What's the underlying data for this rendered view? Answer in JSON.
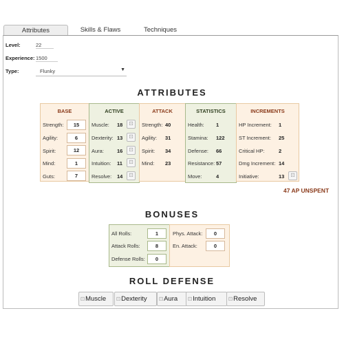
{
  "tabs": [
    "Attributes",
    "Skills & Flaws",
    "Techniques"
  ],
  "fields": {
    "level_label": "Level:",
    "level": "22",
    "experience_label": "Experience:",
    "experience": "1500",
    "type_label": "Type:",
    "type": "Flunky"
  },
  "headings": {
    "attributes": "ATTRIBUTES",
    "bonuses": "BONUSES",
    "roll_defense": "ROLL DEFENSE"
  },
  "base": {
    "title": "BASE",
    "rows": [
      {
        "label": "Strength:",
        "value": "15"
      },
      {
        "label": "Agility:",
        "value": "6"
      },
      {
        "label": "Spirit:",
        "value": "12"
      },
      {
        "label": "Mind:",
        "value": "1"
      },
      {
        "label": "Guts:",
        "value": "7"
      }
    ]
  },
  "active": {
    "title": "ACTIVE",
    "rows": [
      {
        "label": "Muscle:",
        "value": "18"
      },
      {
        "label": "Dexterity:",
        "value": "13"
      },
      {
        "label": "Aura:",
        "value": "16"
      },
      {
        "label": "Intuition:",
        "value": "11"
      },
      {
        "label": "Resolve:",
        "value": "14"
      }
    ]
  },
  "attack": {
    "title": "ATTACK",
    "rows": [
      {
        "label": "Strength:",
        "value": "40"
      },
      {
        "label": "Agility:",
        "value": "31"
      },
      {
        "label": "Spirit:",
        "value": "34"
      },
      {
        "label": "Mind:",
        "value": "23"
      }
    ]
  },
  "statistics": {
    "title": "STATISTICS",
    "rows": [
      {
        "label": "Health:",
        "value": "1"
      },
      {
        "label": "Stamina:",
        "value": "122"
      },
      {
        "label": "Defense:",
        "value": "66"
      },
      {
        "label": "Resistance:",
        "value": "57"
      },
      {
        "label": "Move:",
        "value": "4"
      }
    ]
  },
  "increments": {
    "title": "INCREMENTS",
    "rows": [
      {
        "label": "HP Increment:",
        "value": "1"
      },
      {
        "label": "ST Increment:",
        "value": "25"
      },
      {
        "label": "Critical HP:",
        "value": "2"
      },
      {
        "label": "Dmg Increment:",
        "value": "14"
      },
      {
        "label": "Initiative:",
        "value": "13"
      }
    ]
  },
  "ap_unspent": "47 AP UNSPENT",
  "bonuses_left": [
    {
      "label": "All Rolls:",
      "value": "1"
    },
    {
      "label": "Attack Rolls:",
      "value": "8"
    },
    {
      "label": "Defense Rolls:",
      "value": "0"
    }
  ],
  "bonuses_right": [
    {
      "label": "Phys. Attack:",
      "value": "0"
    },
    {
      "label": "En. Attack:",
      "value": "0"
    }
  ],
  "roll_buttons": [
    "Muscle",
    "Dexterity",
    "Aura",
    "Intuition",
    "Resolve"
  ],
  "icons": {
    "dice": "dice-icon"
  }
}
